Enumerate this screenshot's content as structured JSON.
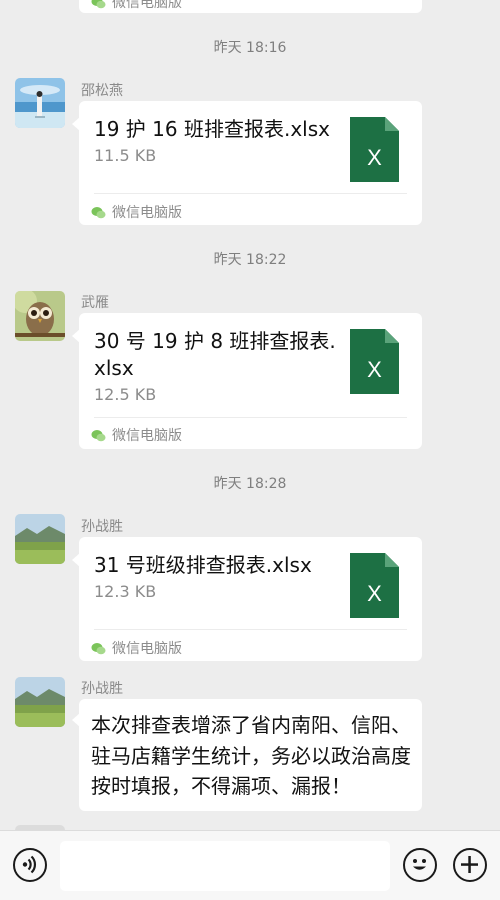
{
  "top_card": {
    "source_label": "微信电脑版"
  },
  "messages": [
    {
      "timestamp": "昨天 18:16",
      "sender": "邵松燕",
      "file_name": "19 护 16 班排查报表.xlsx",
      "file_size": "11.5 KB",
      "source_label": "微信电脑版"
    },
    {
      "timestamp": "昨天 18:22",
      "sender": "武雁",
      "file_name": "30 号 19 护 8 班排查报表.xlsx",
      "file_size": "12.5 KB",
      "source_label": "微信电脑版"
    },
    {
      "timestamp": "昨天 18:28",
      "sender": "孙战胜",
      "file_name": "31 号班级排查报表.xlsx",
      "file_size": "12.3 KB",
      "source_label": "微信电脑版"
    }
  ],
  "text_message": {
    "sender": "孙战胜",
    "text": "本次排查表增添了省内南阳、信阳、驻马店籍学生统计，务必以政治高度按时填报，不得漏项、漏报！"
  },
  "file_icon_letter": "X",
  "colors": {
    "excel_green": "#1d7044",
    "background": "#ededed",
    "wechat_green": "#7bc45a"
  },
  "input_bar": {
    "voice_icon": "voice-icon",
    "emoji_icon": "emoji-icon",
    "plus_icon": "plus-icon",
    "value": ""
  }
}
